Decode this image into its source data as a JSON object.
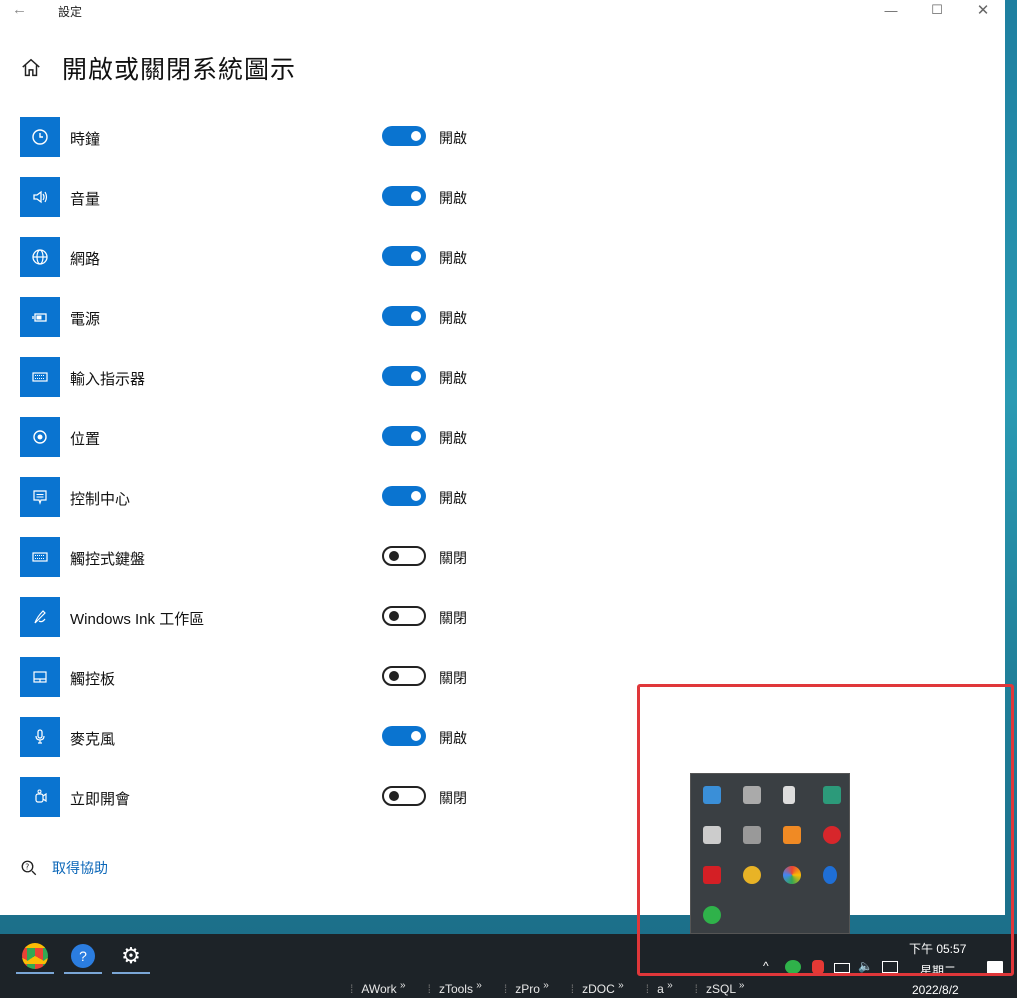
{
  "window": {
    "title": "設定",
    "page_title": "開啟或關閉系統圖示"
  },
  "items": [
    {
      "label": "時鐘",
      "state": "開啟",
      "on": true,
      "icon": "clock-icon"
    },
    {
      "label": "音量",
      "state": "開啟",
      "on": true,
      "icon": "volume-icon"
    },
    {
      "label": "網路",
      "state": "開啟",
      "on": true,
      "icon": "globe-icon"
    },
    {
      "label": "電源",
      "state": "開啟",
      "on": true,
      "icon": "battery-icon"
    },
    {
      "label": "輸入指示器",
      "state": "開啟",
      "on": true,
      "icon": "keyboard-icon"
    },
    {
      "label": "位置",
      "state": "開啟",
      "on": true,
      "icon": "location-icon"
    },
    {
      "label": "控制中心",
      "state": "開啟",
      "on": true,
      "icon": "action-center-icon"
    },
    {
      "label": "觸控式鍵盤",
      "state": "關閉",
      "on": false,
      "icon": "touch-keyboard-icon"
    },
    {
      "label": "Windows Ink 工作區",
      "state": "關閉",
      "on": false,
      "icon": "pen-icon"
    },
    {
      "label": "觸控板",
      "state": "關閉",
      "on": false,
      "icon": "touchpad-icon"
    },
    {
      "label": "麥克風",
      "state": "開啟",
      "on": true,
      "icon": "microphone-icon"
    },
    {
      "label": "立即開會",
      "state": "關閉",
      "on": false,
      "icon": "meet-now-icon"
    }
  ],
  "help": {
    "label": "取得協助"
  },
  "taskbar": {
    "toolbars": [
      "AWork",
      "zTools",
      "zPro",
      "zDOC",
      "a",
      "zSQL"
    ],
    "clock_time": "下午 05:57",
    "clock_day": "星期二",
    "clock_date": "2022/8/2"
  },
  "colors": {
    "accent": "#0a74d0",
    "highlight": "#e0373a"
  }
}
